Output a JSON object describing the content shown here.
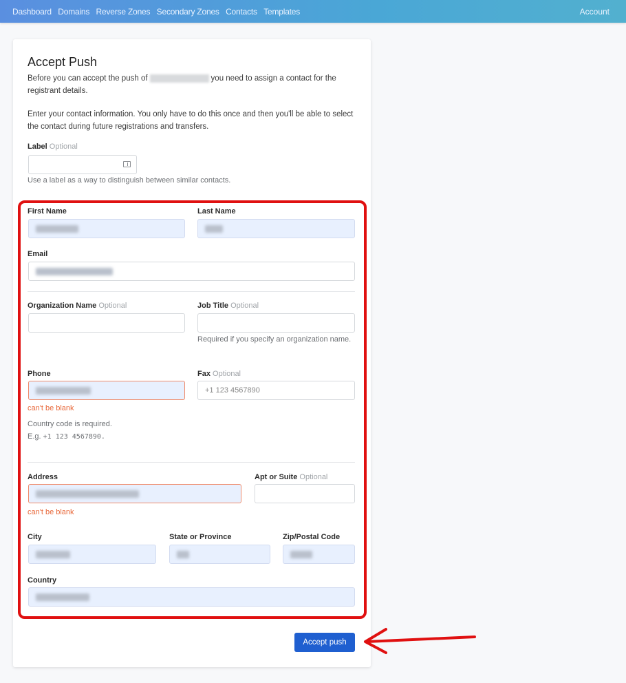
{
  "nav": {
    "items": [
      "Dashboard",
      "Domains",
      "Reverse Zones",
      "Secondary Zones",
      "Contacts",
      "Templates"
    ],
    "account": "Account"
  },
  "page": {
    "title": "Accept Push",
    "intro_1_before": "Before you can accept the push of",
    "intro_1_after": "you need to assign a contact for the registrant details.",
    "intro_2": "Enter your contact information. You only have to do this once and then you'll be able to select the contact during future registrations and transfers."
  },
  "form": {
    "optional": "Optional",
    "label": {
      "label": "Label",
      "help": "Use a label as a way to distinguish between similar contacts."
    },
    "first_name": {
      "label": "First Name"
    },
    "last_name": {
      "label": "Last Name"
    },
    "email": {
      "label": "Email"
    },
    "organization": {
      "label": "Organization Name"
    },
    "job_title": {
      "label": "Job Title",
      "help": "Required if you specify an organization name."
    },
    "phone": {
      "label": "Phone",
      "error": "can't be blank",
      "help_line1": "Country code is required.",
      "help_line2_prefix": "E.g.",
      "help_line2_example": "+1 123 4567890."
    },
    "fax": {
      "label": "Fax",
      "placeholder": "+1 123 4567890"
    },
    "address": {
      "label": "Address",
      "error": "can't be blank"
    },
    "apt": {
      "label": "Apt or Suite"
    },
    "city": {
      "label": "City"
    },
    "state": {
      "label": "State or Province"
    },
    "zip": {
      "label": "Zip/Postal Code"
    },
    "country": {
      "label": "Country"
    },
    "submit": "Accept push"
  },
  "colors": {
    "nav_gradient_start": "#5a8fe0",
    "nav_gradient_end": "#52b0cf",
    "button": "#1f5fd0",
    "error": "#e8683a",
    "annotation": "#e01010"
  }
}
